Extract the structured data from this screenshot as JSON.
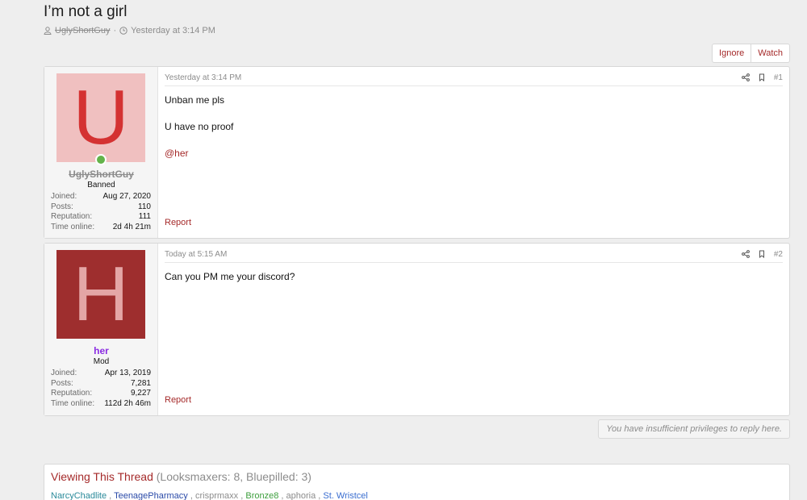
{
  "thread": {
    "title": "I’m not a girl",
    "author": "UglyShortGuy",
    "separator": "·",
    "date": "Yesterday at 3:14 PM"
  },
  "buttons": {
    "ignore": "Ignore",
    "watch": "Watch"
  },
  "posts": [
    {
      "avatar_letter": "U",
      "username": "UglyShortGuy",
      "user_title": "Banned",
      "stats": [
        {
          "label": "Joined:",
          "value": "Aug 27, 2020"
        },
        {
          "label": "Posts:",
          "value": "110"
        },
        {
          "label": "Reputation:",
          "value": "111"
        },
        {
          "label": "Time online:",
          "value": "2d 4h 21m"
        }
      ],
      "date": "Yesterday at 3:14 PM",
      "number": "#1",
      "lines": [
        "Unban me pls",
        "U have no proof"
      ],
      "mention": "@her",
      "report": "Report"
    },
    {
      "avatar_letter": "H",
      "username": "her",
      "user_title": "Mod",
      "stats": [
        {
          "label": "Joined:",
          "value": "Apr 13, 2019"
        },
        {
          "label": "Posts:",
          "value": "7,281"
        },
        {
          "label": "Reputation:",
          "value": "9,227"
        },
        {
          "label": "Time online:",
          "value": "112d 2h 46m"
        }
      ],
      "date": "Today at 5:15 AM",
      "number": "#2",
      "lines": [
        "Can you PM me your discord?"
      ],
      "report": "Report"
    }
  ],
  "notice": "You have insufficient privileges to reply here.",
  "viewing": {
    "title": "Viewing This Thread",
    "counts": "(Looksmaxers: 8, Bluepilled: 3)",
    "users": [
      "NarcyChadlite",
      "TeenagePharmacy",
      "crisprmaxx",
      "Bronze8",
      "aphoria",
      "St. Wristcel"
    ],
    "sep": ","
  },
  "colors": {
    "accent": "#a52a2a",
    "mod": "#8a2be2",
    "online": "#63b34a",
    "avatar_u_bg": "#f0c0c0",
    "avatar_h_bg": "#9e2e2e"
  }
}
